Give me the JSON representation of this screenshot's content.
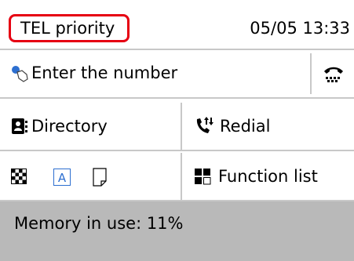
{
  "status": {
    "mode": "TEL priority",
    "datetime": "05/05 13:33"
  },
  "number_entry": {
    "label": "Enter the number",
    "icon": "touch-finger-icon",
    "hook_icon": "on-hook-phone-icon"
  },
  "menu": {
    "directory_label": "Directory",
    "redial_label": "Redial",
    "function_list_label": "Function list",
    "settings_icons": [
      "resolution-icon",
      "scan-text-icon",
      "density-icon"
    ]
  },
  "memory": {
    "label": "Memory in use: 11%"
  },
  "colors": {
    "mode_border": "#e60012",
    "divider": "#c8c8c8",
    "memory_bg": "#b9b9b9",
    "icon_blue": "#2d6fd0"
  }
}
